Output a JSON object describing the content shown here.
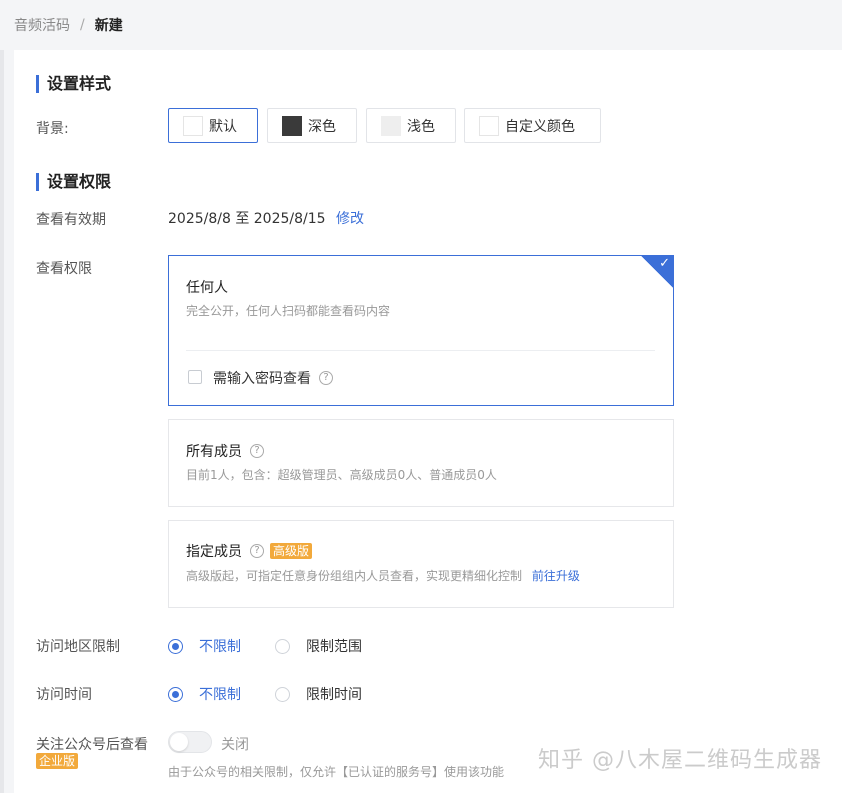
{
  "breadcrumb": {
    "parent": "音频活码",
    "separator": "/",
    "current": "新建"
  },
  "style_section": {
    "title": "设置样式",
    "background_label": "背景:",
    "options": [
      {
        "label": "默认",
        "swatch": "#ffffff",
        "selected": true
      },
      {
        "label": "深色",
        "swatch": "#3a3a3a",
        "selected": false
      },
      {
        "label": "浅色",
        "swatch": "#eeeeee",
        "selected": false
      },
      {
        "label": "自定义颜色",
        "swatch": "#ffffff",
        "selected": false
      }
    ]
  },
  "permission_section": {
    "title": "设置权限",
    "validity_label": "查看有效期",
    "validity_value": "2025/8/8 至 2025/8/15",
    "validity_edit": "修改",
    "view_label": "查看权限",
    "cards": [
      {
        "title": "任何人",
        "desc": "完全公开，任何人扫码都能查看码内容",
        "selected": true,
        "checkbox_label": "需输入密码查看",
        "help": "?"
      },
      {
        "title": "所有成员",
        "desc": "目前1人，包含：超级管理员、高级成员0人、普通成员0人",
        "help": "?"
      },
      {
        "title": "指定成员",
        "badge": "高级版",
        "desc": "高级版起，可指定任意身份组组内人员查看，实现更精细化控制",
        "link": "前往升级",
        "help": "?"
      }
    ],
    "region": {
      "label": "访问地区限制",
      "options": [
        "不限制",
        "限制范围"
      ],
      "selected": 0
    },
    "time": {
      "label": "访问时间",
      "options": [
        "不限制",
        "限制时间"
      ],
      "selected": 0
    },
    "follow": {
      "label": "关注公众号后查看",
      "badge": "企业版",
      "toggle_state": "关闭",
      "note": "由于公众号的相关限制，仅允许【已认证的服务号】使用该功能"
    }
  },
  "watermark": "知乎 @八木屋二维码生成器",
  "colors": {
    "accent": "#3b6fd8",
    "badge": "#f2a93b"
  }
}
